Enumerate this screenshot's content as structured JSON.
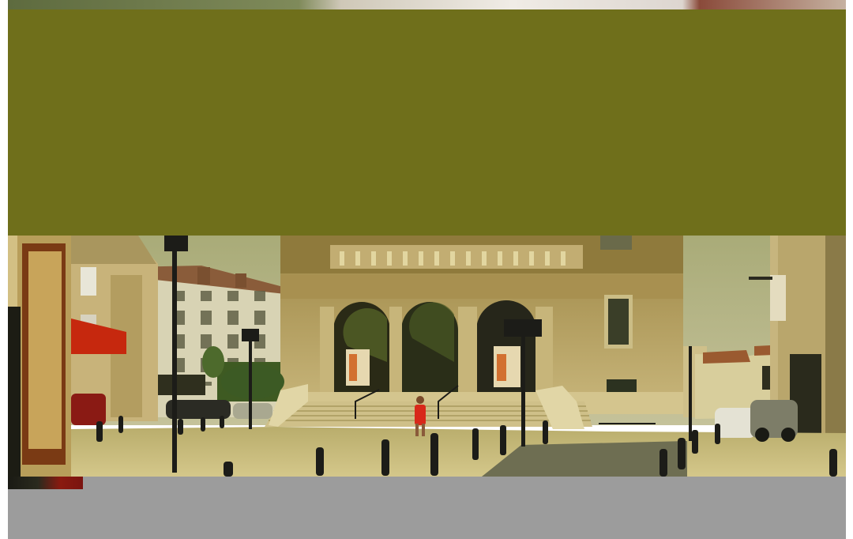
{
  "image": {
    "subject": "sunny square",
    "colors": {
      "olive": "#6f6f1b",
      "gray": "#9c9c9c",
      "sky": "#b8b48a",
      "stone": "#b59a5e",
      "pavement": "#cbbf80",
      "bollard": "#1c1c18",
      "red": "#b81c10"
    }
  }
}
